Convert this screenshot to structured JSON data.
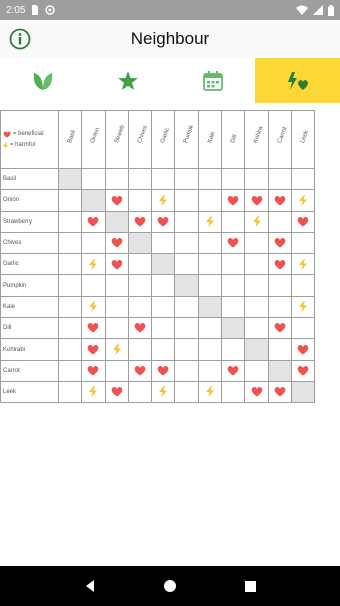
{
  "status": {
    "time": "2:05",
    "icons": [
      "sim-icon",
      "at-icon"
    ],
    "right_icons": [
      "wifi-icon",
      "signal-icon",
      "battery-icon"
    ]
  },
  "app": {
    "title": "Neighbour",
    "info_icon": "info-icon"
  },
  "tabs": [
    {
      "name": "tab-plants",
      "icon": "leaf-icon",
      "active": false
    },
    {
      "name": "tab-pests",
      "icon": "star-leaf-icon",
      "active": false
    },
    {
      "name": "tab-calendar",
      "icon": "calendar-icon",
      "active": false
    },
    {
      "name": "tab-neighbours",
      "icon": "neighbour-icon",
      "active": true
    }
  ],
  "legend": {
    "beneficial": "= beneficial",
    "harmful": "= harmful"
  },
  "colors": {
    "heart": "#ef5350",
    "bolt": "#fbc02d",
    "accent": "#fdd835",
    "green": "#43a047"
  },
  "plants": [
    "Basil",
    "Onion",
    "Strawberry",
    "Chives",
    "Garlic",
    "Pumpkin",
    "Kale",
    "Dill",
    "Kohlrabi",
    "Carrot",
    "Leek"
  ],
  "col_labels": [
    "Basil",
    "Onion",
    "Strawb",
    "Chives",
    "Garlic",
    "Pumpk",
    "Kale",
    "Dill",
    "Kohlra",
    "Carrot",
    "Leek"
  ],
  "matrix": [
    [
      "",
      "",
      "",
      "",
      "",
      "",
      "",
      "",
      "",
      "",
      ""
    ],
    [
      "",
      "",
      "h",
      "",
      "b",
      "",
      "",
      "h",
      "h",
      "h",
      "b"
    ],
    [
      "",
      "h",
      "",
      "h",
      "h",
      "",
      "b",
      "",
      "b",
      "",
      "h"
    ],
    [
      "",
      "",
      "h",
      "",
      "",
      "",
      "",
      "h",
      "",
      "h",
      ""
    ],
    [
      "",
      "b",
      "h",
      "",
      "",
      "",
      "",
      "",
      "",
      "h",
      "b"
    ],
    [
      "",
      "",
      "",
      "",
      "",
      "",
      "",
      "",
      "",
      "",
      ""
    ],
    [
      "",
      "b",
      "",
      "",
      "",
      "",
      "",
      "",
      "",
      "",
      "b"
    ],
    [
      "",
      "h",
      "",
      "h",
      "",
      "",
      "",
      "",
      "",
      "h",
      ""
    ],
    [
      "",
      "h",
      "b",
      "",
      "",
      "",
      "",
      "",
      "",
      "",
      "h"
    ],
    [
      "",
      "h",
      "",
      "h",
      "h",
      "",
      "",
      "h",
      "",
      "",
      "h"
    ],
    [
      "",
      "b",
      "h",
      "",
      "b",
      "",
      "b",
      "",
      "h",
      "h",
      ""
    ]
  ],
  "nav": [
    "back-icon",
    "home-icon",
    "recents-icon"
  ]
}
